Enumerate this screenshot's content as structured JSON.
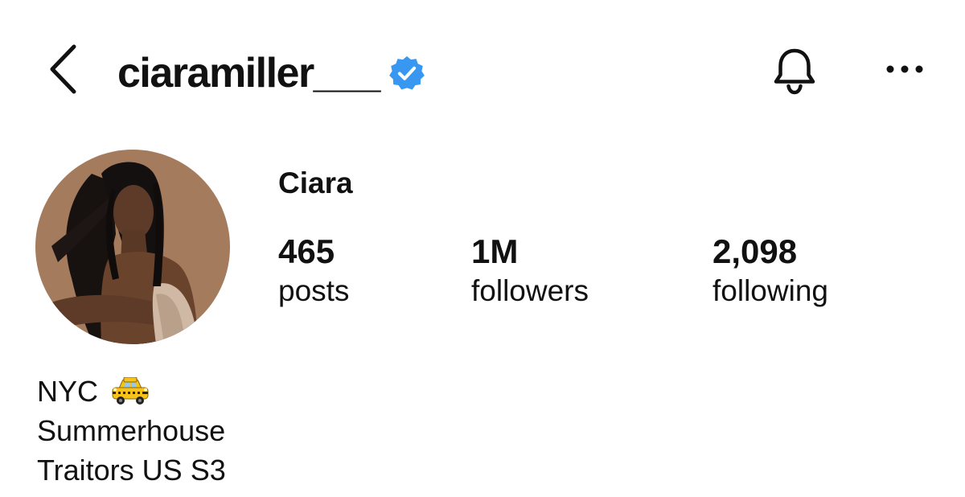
{
  "header": {
    "username": "ciaramiller___",
    "verified": true,
    "icons": {
      "back": "chevron-left-icon",
      "verified": "verified-badge-icon",
      "notifications": "bell-icon",
      "more": "more-horizontal-icon"
    }
  },
  "profile": {
    "display_name": "Ciara",
    "stats": [
      {
        "value": "465",
        "label": "posts"
      },
      {
        "value": "1M",
        "label": "followers"
      },
      {
        "value": "2,098",
        "label": "following"
      }
    ]
  },
  "bio": {
    "lines": [
      "NYC",
      "Summerhouse",
      "Traitors US S3"
    ],
    "emoji_icon": "taxi-icon"
  },
  "colors": {
    "text": "#111111",
    "verified_badge": "#3897f0",
    "avatar_background": "#a47b5d"
  }
}
